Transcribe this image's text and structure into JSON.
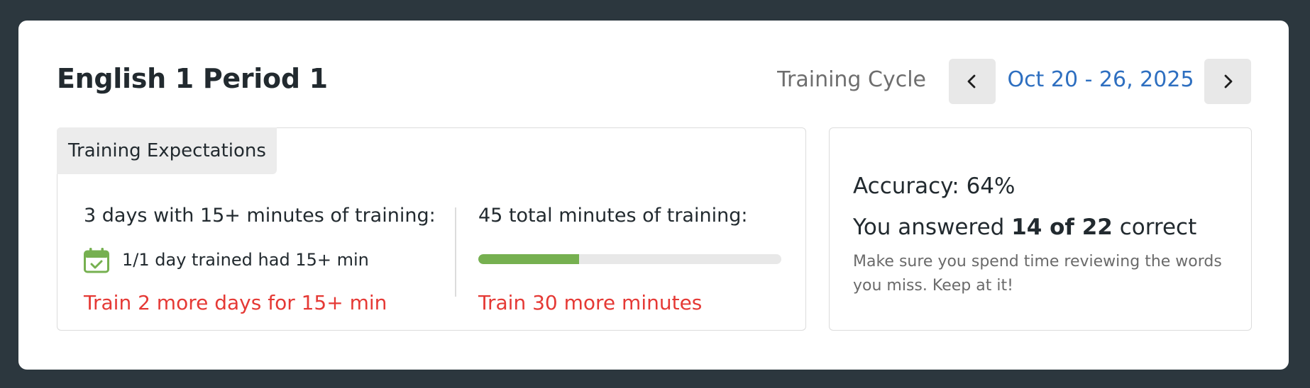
{
  "header": {
    "title": "English 1 Period 1",
    "cycle_label": "Training Cycle",
    "cycle_date": "Oct 20 - 26, 2025",
    "prev_icon": "chevron-left-icon",
    "next_icon": "chevron-right-icon"
  },
  "expectations": {
    "tab_label": "Training Expectations",
    "days": {
      "heading": "3 days with 15+ minutes of training:",
      "icon": "calendar-check-icon",
      "trained_text": "1/1 day trained had 15+ min",
      "warning": "Train 2 more days for 15+ min"
    },
    "minutes": {
      "heading": "45 total minutes of training:",
      "progress_fraction": 0.333,
      "warning": "Train 30 more minutes"
    }
  },
  "accuracy": {
    "heading": "Accuracy: 64%",
    "answered_prefix": "You answered",
    "answered_count": "14 of 22",
    "answered_suffix": "correct",
    "hint": "Make sure you spend time reviewing the words you miss. Keep at it!"
  },
  "colors": {
    "background": "#2c373e",
    "link": "#2e6fc0",
    "warning": "#e53935",
    "progress": "#76b050"
  }
}
